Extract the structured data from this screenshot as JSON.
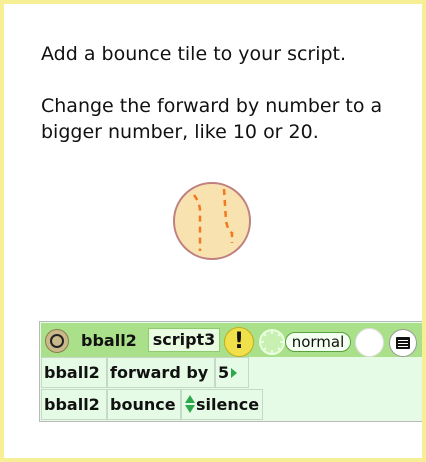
{
  "instructions": {
    "line1": "Add a bounce tile to your script.",
    "line2": "Change the forward by number to a bigger number, like 10 or 20."
  },
  "ball": {
    "fill": "#f7e2b0",
    "outline": "#c08080",
    "stripe_color": "#f07a20"
  },
  "script": {
    "header": {
      "object_name": "bball2",
      "script_name": "script3",
      "alert_glyph": "!",
      "status": "normal",
      "icons": [
        "circle-button-icon",
        "alert-icon",
        "clock-icon",
        "menu-icon"
      ]
    },
    "rows": [
      {
        "object": "bball2",
        "command": "forward by",
        "value": "5"
      },
      {
        "object": "bball2",
        "command": "bounce",
        "value": "silence"
      }
    ]
  },
  "colors": {
    "frame_border": "#f7ef95",
    "header_bg": "#abe08b",
    "tile_bg": "#e6fbe6",
    "arrow_green": "#2da84a"
  }
}
